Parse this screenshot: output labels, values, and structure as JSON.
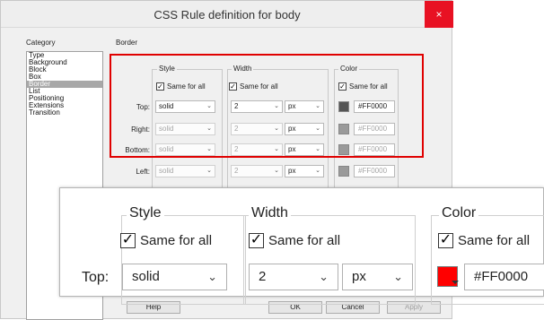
{
  "window": {
    "title": "CSS Rule definition for body",
    "close_glyph": "×"
  },
  "category": {
    "heading": "Category",
    "items": [
      "Type",
      "Background",
      "Block",
      "Box",
      "Border",
      "List",
      "Positioning",
      "Extensions",
      "Transition"
    ],
    "selected": "Border"
  },
  "panel_heading": "Border",
  "groups": {
    "style": "Style",
    "width": "Width",
    "color": "Color"
  },
  "same_for_all": "Same for all",
  "rows": [
    {
      "label": "Top:",
      "style": "solid",
      "width": "2",
      "unit": "px",
      "color": "#FF0000"
    },
    {
      "label": "Right:",
      "style": "solid",
      "width": "2",
      "unit": "px",
      "color": "#FF0000"
    },
    {
      "label": "Bottom:",
      "style": "solid",
      "width": "2",
      "unit": "px",
      "color": "#FF0000"
    },
    {
      "label": "Left:",
      "style": "solid",
      "width": "2",
      "unit": "px",
      "color": "#FF0000"
    }
  ],
  "buttons": {
    "help": "Help",
    "ok": "OK",
    "cancel": "Cancel",
    "apply": "Apply"
  },
  "zoom": {
    "style_legend": "Style",
    "width_legend": "Width",
    "color_legend": "Color",
    "same_for_all": "Same for all",
    "row_label": "Top:",
    "style_value": "solid",
    "width_value": "2",
    "unit_value": "px",
    "color_hex": "#FF0000"
  },
  "colors": {
    "highlight": "#e00000",
    "swatch": "#ff0000",
    "close": "#e81123"
  }
}
